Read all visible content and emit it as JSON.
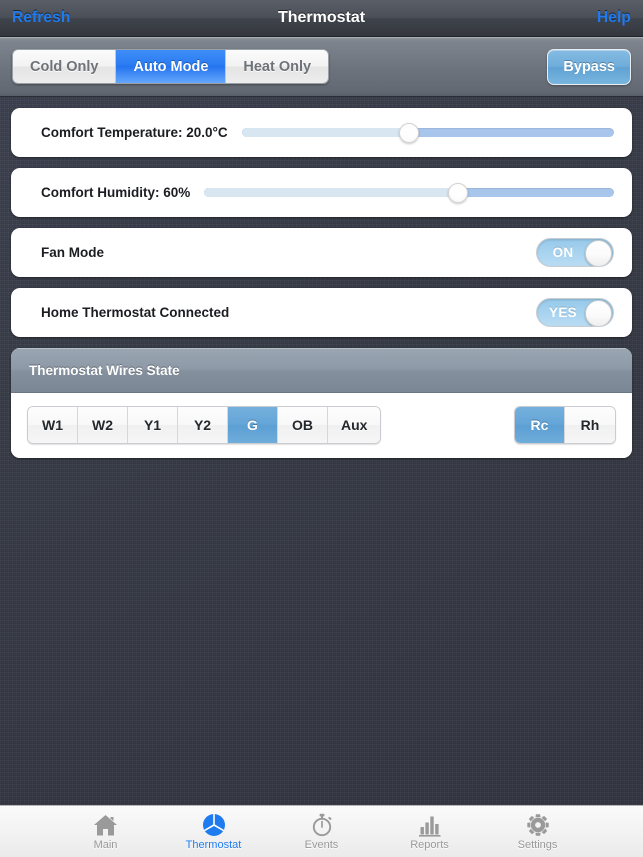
{
  "navbar": {
    "left_button": "Refresh",
    "title": "Thermostat",
    "right_button": "Help"
  },
  "toolbar": {
    "mode_segments": [
      {
        "label": "Cold Only",
        "active": false
      },
      {
        "label": "Auto Mode",
        "active": true
      },
      {
        "label": "Heat Only",
        "active": false
      }
    ],
    "bypass_label": "Bypass"
  },
  "settings": {
    "temperature": {
      "label": "Comfort Temperature: 20.0°C",
      "value": 20.0,
      "unit": "°C",
      "slider_percent": 45
    },
    "humidity": {
      "label": "Comfort Humidity: 60%",
      "value": 60,
      "unit": "%",
      "slider_percent": 62
    },
    "fan_mode": {
      "label": "Fan Mode",
      "toggle_text": "ON",
      "on": true
    },
    "home_thermostat": {
      "label": "Home Thermostat Connected",
      "toggle_text": "YES",
      "on": true
    }
  },
  "wires_panel": {
    "title": "Thermostat Wires State",
    "wires": [
      {
        "label": "W1",
        "active": false
      },
      {
        "label": "W2",
        "active": false
      },
      {
        "label": "Y1",
        "active": false
      },
      {
        "label": "Y2",
        "active": false
      },
      {
        "label": "G",
        "active": true
      },
      {
        "label": "OB",
        "active": false
      },
      {
        "label": "Aux",
        "active": false
      }
    ],
    "power": [
      {
        "label": "Rc",
        "active": true
      },
      {
        "label": "Rh",
        "active": false
      }
    ]
  },
  "tabbar": {
    "tabs": [
      {
        "label": "Main",
        "icon": "home-icon",
        "active": false
      },
      {
        "label": "Thermostat",
        "icon": "thermostat-icon",
        "active": true
      },
      {
        "label": "Events",
        "icon": "stopwatch-icon",
        "active": false
      },
      {
        "label": "Reports",
        "icon": "bar-chart-icon",
        "active": false
      },
      {
        "label": "Settings",
        "icon": "gear-icon",
        "active": false
      }
    ]
  },
  "colors": {
    "accent_blue": "#1f7bf0",
    "segment_blue": "#2a7cf2",
    "wire_blue": "#64a5d7",
    "toggle_blue": "#a8d3ef",
    "background": "#383c46"
  }
}
